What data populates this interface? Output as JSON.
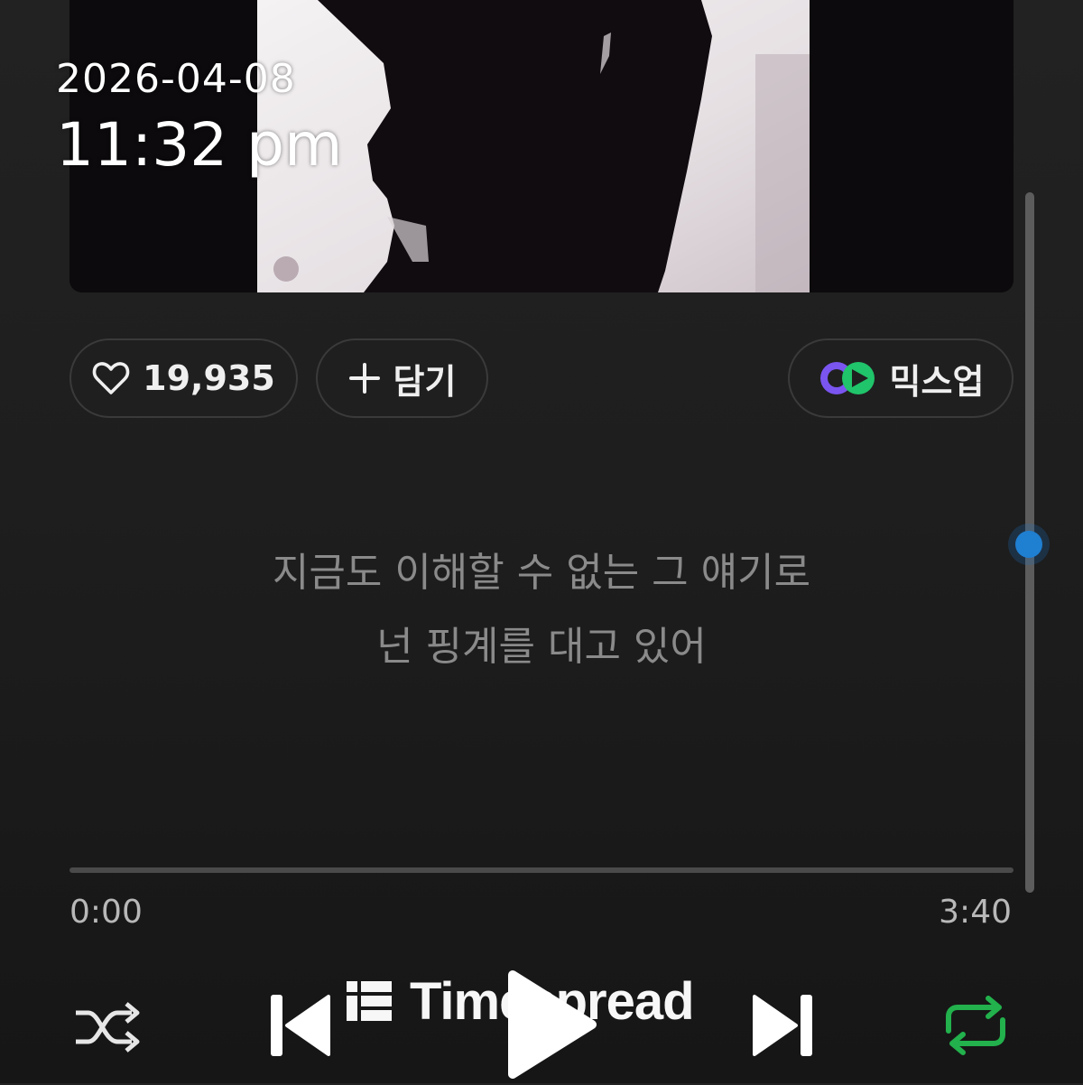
{
  "overlay": {
    "date": "2026-04-08",
    "time": "11:32 pm"
  },
  "actions": {
    "like_count": "19,935",
    "add_label": "담기",
    "mixup_label": "믹스업"
  },
  "lyrics": {
    "line_1": "지금도 이해할 수 없는 그 얘기로",
    "line_2": "넌 핑계를 대고 있어"
  },
  "player": {
    "elapsed": "0:00",
    "total": "3:40",
    "progress_fraction": 0,
    "repeat_active": true
  },
  "watermark": {
    "text": "Timespread"
  },
  "colors": {
    "background": "#1e1e1e",
    "accent_green": "#22b14c",
    "scroll_thumb": "#1f7fd1",
    "lyric_text": "#8a8a8a"
  },
  "icons": {
    "like": "heart-icon",
    "add": "plus-icon",
    "mixup": "mixup-logo-icon",
    "shuffle": "shuffle-icon",
    "previous": "skip-previous-icon",
    "play": "play-icon",
    "next": "skip-next-icon",
    "repeat": "repeat-icon"
  }
}
